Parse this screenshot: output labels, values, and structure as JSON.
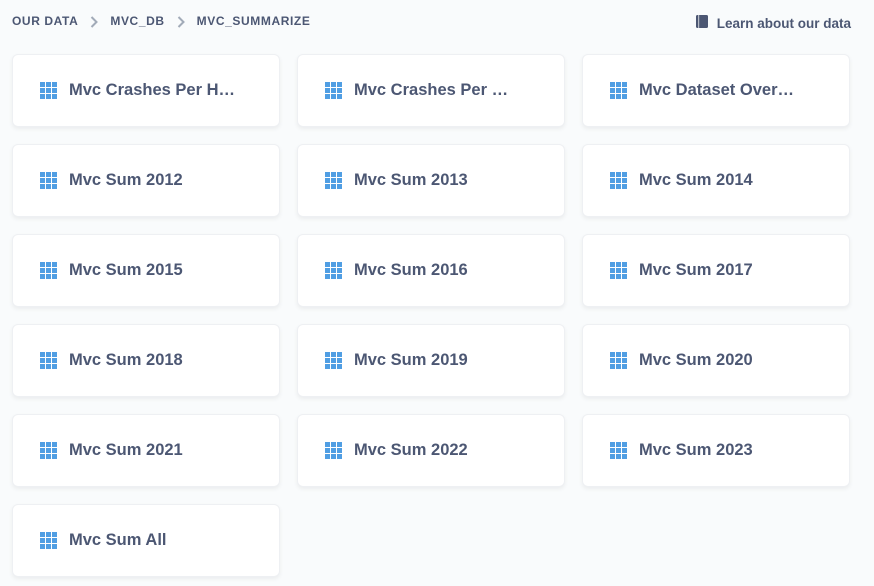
{
  "breadcrumb": {
    "items": [
      "OUR DATA",
      "MVC_DB",
      "MVC_SUMMARIZE"
    ]
  },
  "header": {
    "learn_label": "Learn about our data",
    "learn_icon": "book-icon"
  },
  "colors": {
    "accent": "#509ee3",
    "text": "#4c5773",
    "background": "#f9fbfc"
  },
  "tables": [
    {
      "label": "Mvc Crashes Per H…",
      "icon": "table-grid-icon"
    },
    {
      "label": "Mvc Crashes Per …",
      "icon": "table-grid-icon"
    },
    {
      "label": "Mvc Dataset Over…",
      "icon": "table-grid-icon"
    },
    {
      "label": "Mvc Sum 2012",
      "icon": "table-grid-icon"
    },
    {
      "label": "Mvc Sum 2013",
      "icon": "table-grid-icon"
    },
    {
      "label": "Mvc Sum 2014",
      "icon": "table-grid-icon"
    },
    {
      "label": "Mvc Sum 2015",
      "icon": "table-grid-icon"
    },
    {
      "label": "Mvc Sum 2016",
      "icon": "table-grid-icon"
    },
    {
      "label": "Mvc Sum 2017",
      "icon": "table-grid-icon"
    },
    {
      "label": "Mvc Sum 2018",
      "icon": "table-grid-icon"
    },
    {
      "label": "Mvc Sum 2019",
      "icon": "table-grid-icon"
    },
    {
      "label": "Mvc Sum 2020",
      "icon": "table-grid-icon"
    },
    {
      "label": "Mvc Sum 2021",
      "icon": "table-grid-icon"
    },
    {
      "label": "Mvc Sum 2022",
      "icon": "table-grid-icon"
    },
    {
      "label": "Mvc Sum 2023",
      "icon": "table-grid-icon"
    },
    {
      "label": "Mvc Sum All",
      "icon": "table-grid-icon"
    }
  ]
}
